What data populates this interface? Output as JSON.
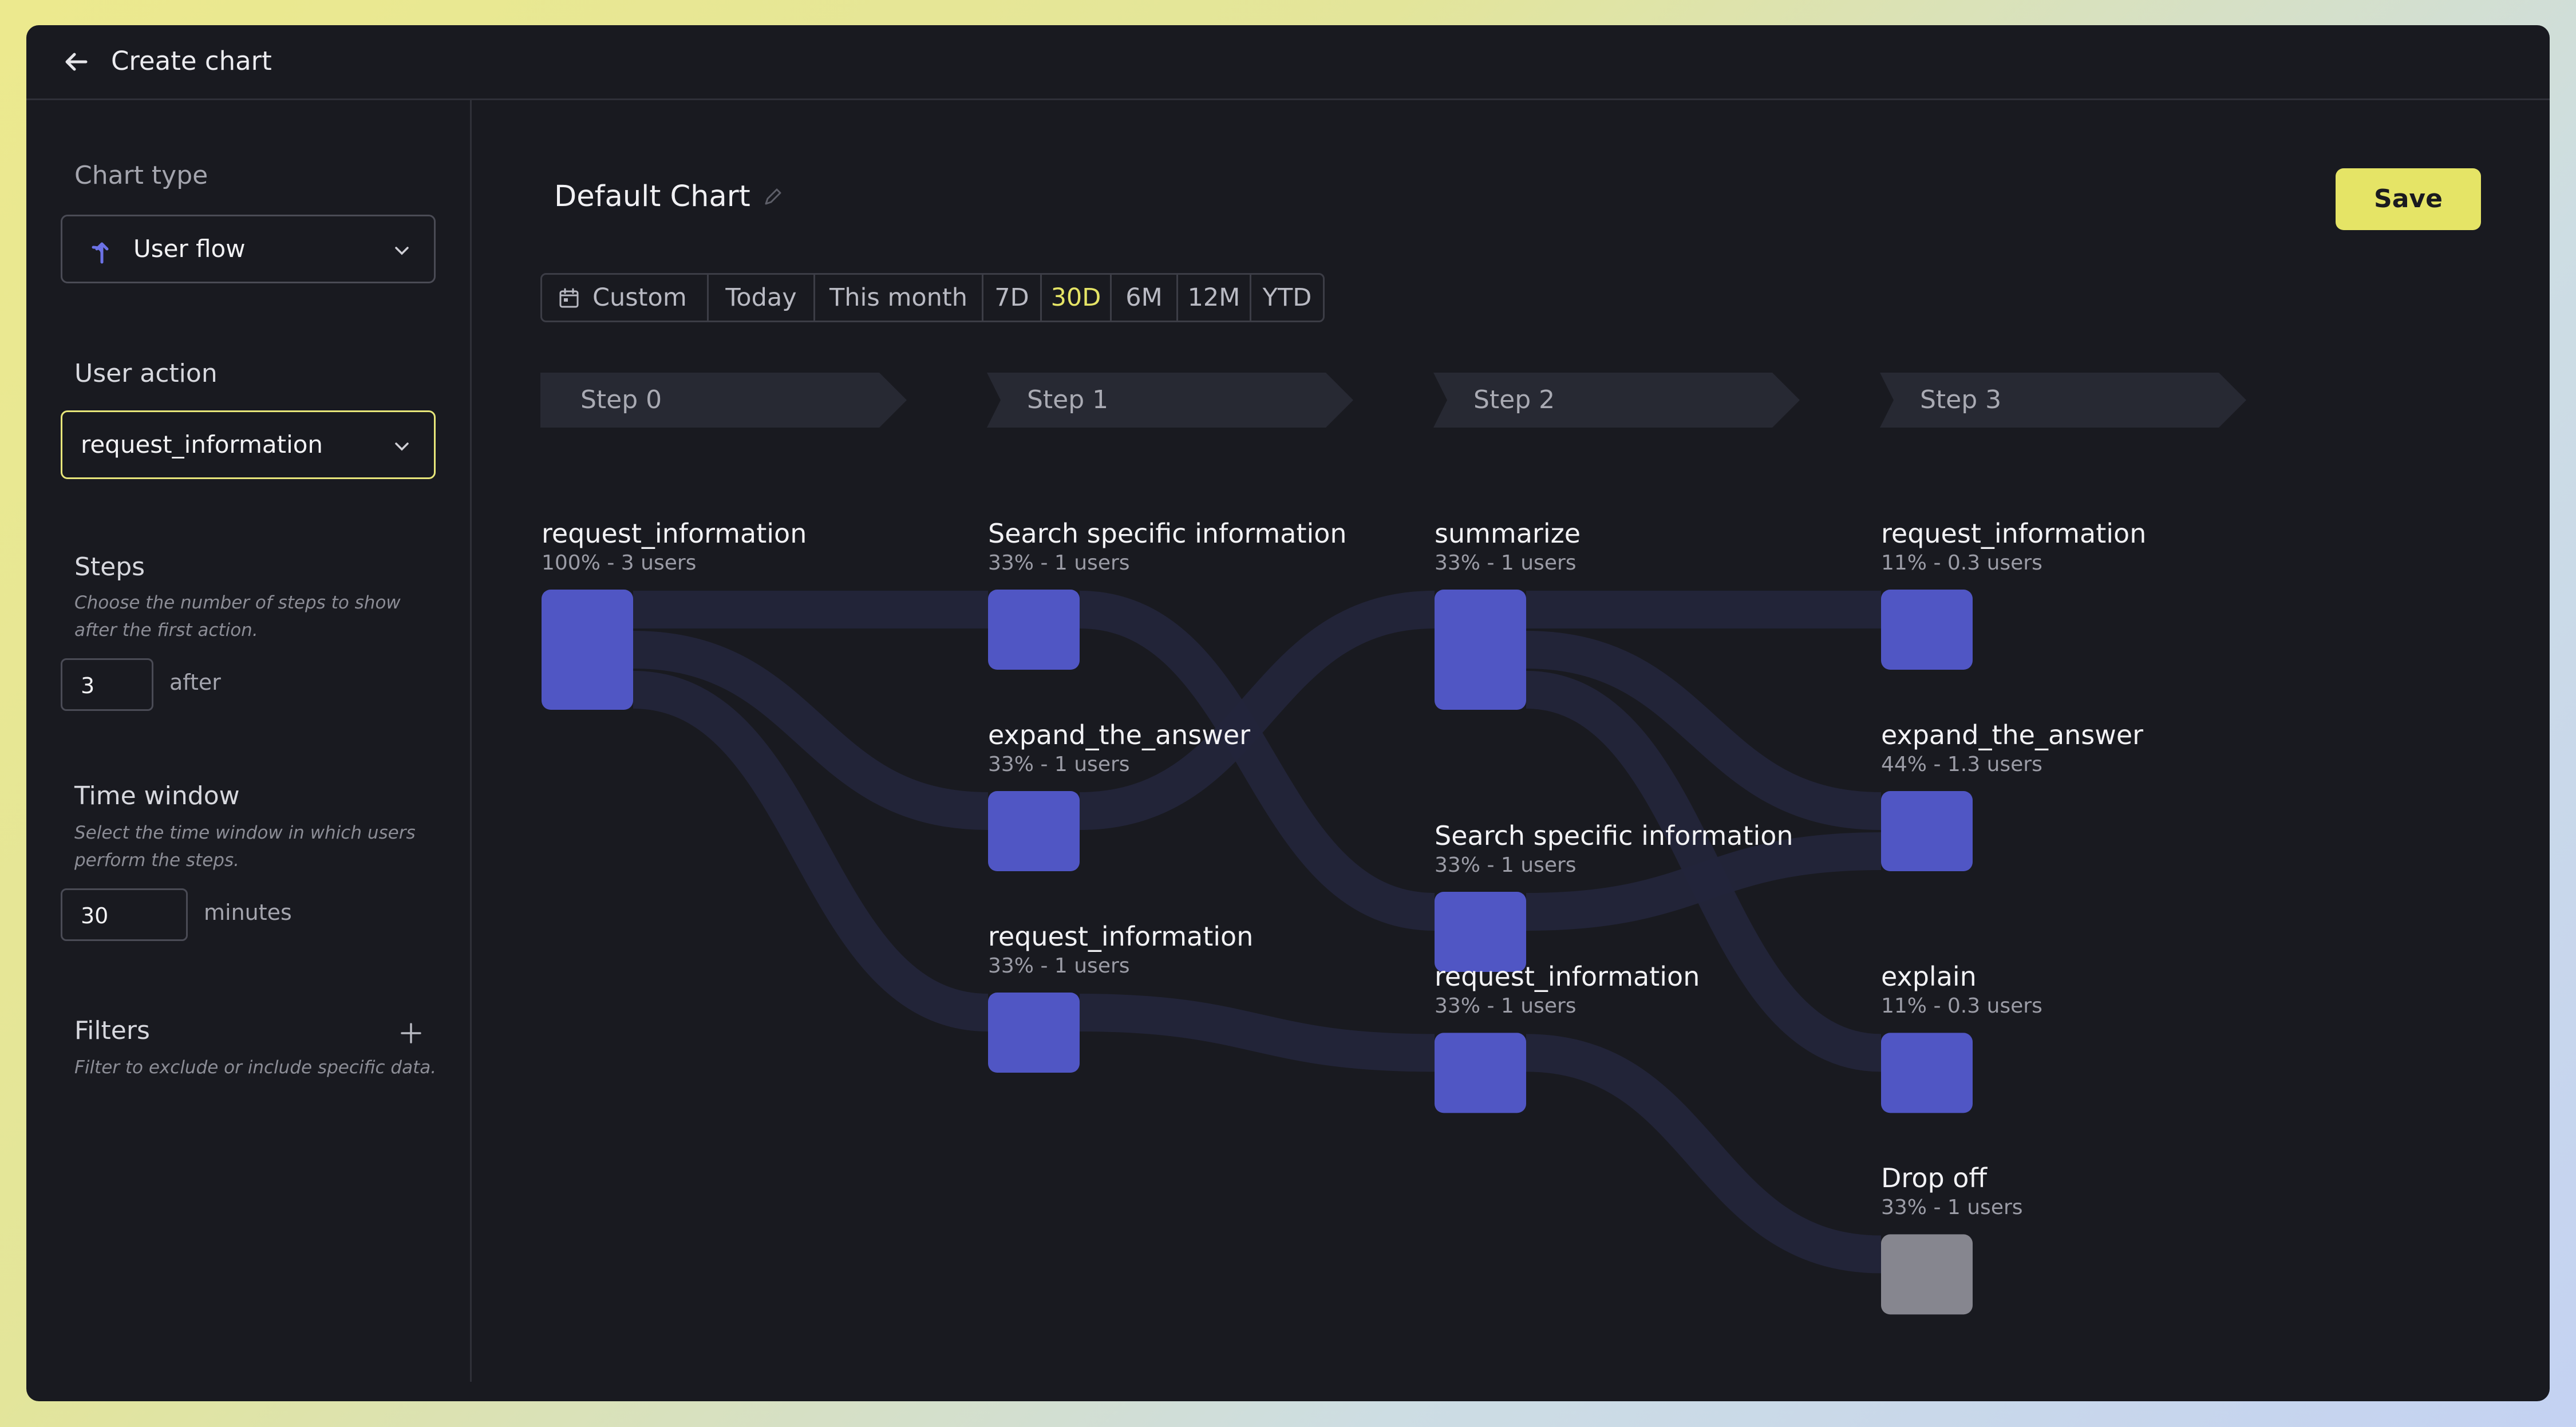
{
  "header": {
    "title": "Create chart"
  },
  "sidebar": {
    "chart_type": {
      "label": "Chart type",
      "value": "User flow"
    },
    "user_action": {
      "label": "User action",
      "value": "request_information"
    },
    "steps": {
      "label": "Steps",
      "hint": "Choose the number of steps to show after the first action.",
      "value": "3",
      "unit": "after"
    },
    "time_window": {
      "label": "Time window",
      "hint": "Select the time window in which users perform the steps.",
      "value": "30",
      "unit": "minutes"
    },
    "filters": {
      "label": "Filters",
      "hint": "Filter to exclude or include specific data."
    }
  },
  "main": {
    "title": "Default Chart",
    "save_label": "Save",
    "ranges": [
      "Custom",
      "Today",
      "This month",
      "7D",
      "30D",
      "6M",
      "12M",
      "YTD"
    ],
    "selected_range": "30D"
  },
  "flow": {
    "steps": [
      "Step 0",
      "Step 1",
      "Step 2",
      "Step 3"
    ],
    "nodes": [
      {
        "name": "request_information",
        "detail": "100% - 3 users",
        "step": 0,
        "users": 3
      },
      {
        "name": "Search specific information",
        "detail": "33% - 1 users",
        "step": 1,
        "users": 1
      },
      {
        "name": "expand_the_answer",
        "detail": "33% - 1 users",
        "step": 1,
        "users": 1
      },
      {
        "name": "request_information",
        "detail": "33% - 1 users",
        "step": 1,
        "users": 1
      },
      {
        "name": "summarize",
        "detail": "33% - 1 users",
        "step": 2,
        "users": 1
      },
      {
        "name": "Search specific information",
        "detail": "33% - 1 users",
        "step": 2,
        "users": 1
      },
      {
        "name": "request_information",
        "detail": "33% - 1 users",
        "step": 2,
        "users": 1
      },
      {
        "name": "request_information",
        "detail": "11% - 0.3 users",
        "step": 3,
        "users": 0.3
      },
      {
        "name": "expand_the_answer",
        "detail": "44% - 1.3 users",
        "step": 3,
        "users": 1.3
      },
      {
        "name": "explain",
        "detail": "11% - 0.3 users",
        "step": 3,
        "users": 0.3
      },
      {
        "name": "Drop off",
        "detail": "33% - 1 users",
        "step": 3,
        "users": 1,
        "drop_off": true
      }
    ],
    "links": [
      {
        "from": 0,
        "to": 1
      },
      {
        "from": 0,
        "to": 2
      },
      {
        "from": 0,
        "to": 3
      },
      {
        "from": 1,
        "to": 5
      },
      {
        "from": 2,
        "to": 4
      },
      {
        "from": 3,
        "to": 6
      },
      {
        "from": 4,
        "to": 7
      },
      {
        "from": 4,
        "to": 8
      },
      {
        "from": 4,
        "to": 9
      },
      {
        "from": 5,
        "to": 8
      },
      {
        "from": 6,
        "to": 10
      }
    ],
    "colors": {
      "node": "#5056c4",
      "drop_off": "#86868f",
      "link": "#23253a"
    }
  }
}
